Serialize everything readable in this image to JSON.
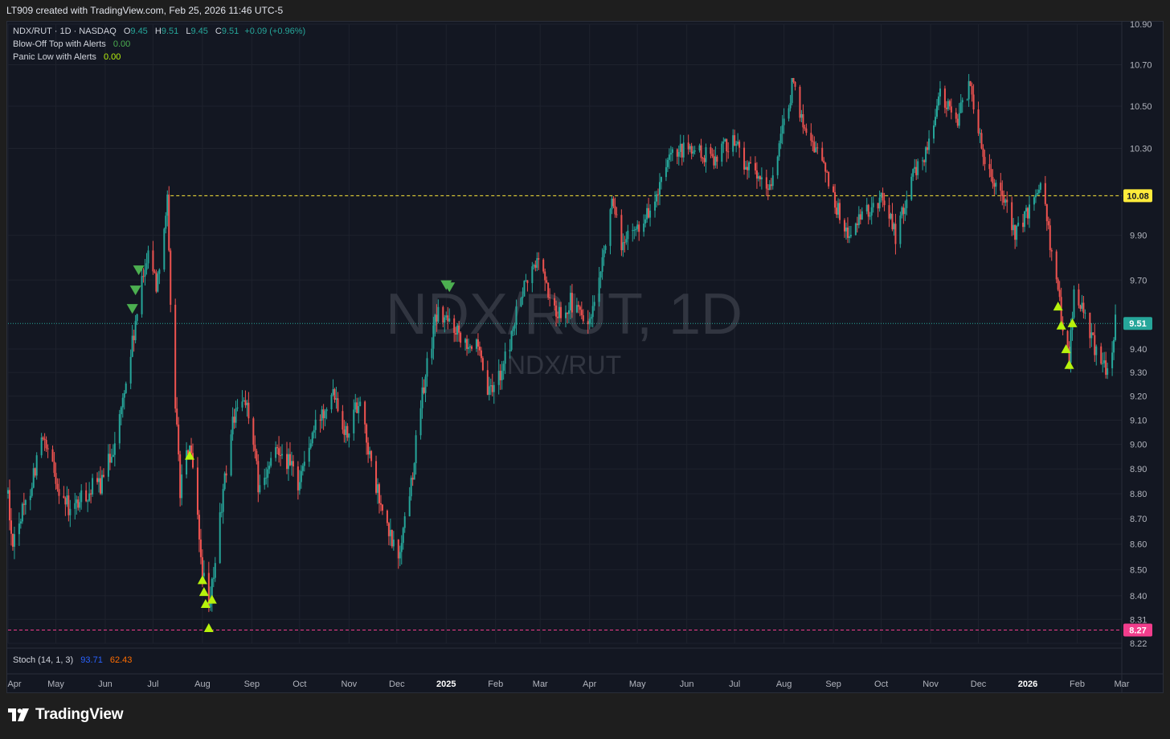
{
  "header": {
    "attribution": "LT909 created with TradingView.com, Feb 25, 2026 11:46 UTC-5"
  },
  "legend": {
    "symbol": "NDX/RUT · 1D · NASDAQ",
    "o_label": "O",
    "o_value": "9.45",
    "h_label": "H",
    "h_value": "9.51",
    "l_label": "L",
    "l_value": "9.45",
    "c_label": "C",
    "c_value": "9.51",
    "change": "+0.09 (+0.96%)",
    "indicators": [
      {
        "name": "Blow-Off Top with Alerts",
        "value": "0.00"
      },
      {
        "name": "Panic Low with Alerts",
        "value": "0.00"
      }
    ]
  },
  "watermark": {
    "main": "NDX/RUT, 1D",
    "sub": "NDX/RUT"
  },
  "stoch": {
    "name": "Stoch (14, 1, 3)",
    "k": "93.71",
    "d": "62.43"
  },
  "footer": {
    "brand": "TradingView"
  },
  "colors": {
    "up": "#26a69a",
    "down": "#ef5350",
    "grid": "#1e222d",
    "axis_text": "#b2b5be",
    "resistance": "#ffeb3b",
    "support": "#f23d8c",
    "buy_marker": "#b8f20c",
    "sell_marker": "#4caf50",
    "last_price_label": "#26a69a"
  },
  "chart_data": {
    "type": "candlestick",
    "scale": "log",
    "ylim": [
      8.22,
      10.9
    ],
    "y_ticks": [
      10.9,
      10.7,
      10.5,
      10.3,
      9.9,
      9.7,
      9.4,
      9.3,
      9.2,
      9.1,
      9.0,
      8.9,
      8.8,
      8.7,
      8.6,
      8.5,
      8.4,
      8.31,
      8.22
    ],
    "x_ticks": [
      "Apr",
      "May",
      "Jun",
      "Jul",
      "Aug",
      "Sep",
      "Oct",
      "Nov",
      "Dec",
      "2025",
      "Feb",
      "Mar",
      "Apr",
      "May",
      "Jun",
      "Jul",
      "Aug",
      "Sep",
      "Oct",
      "Nov",
      "Dec",
      "2026",
      "Feb",
      "Mar"
    ],
    "x_start": "2024-04-01",
    "x_end": "2026-03-01",
    "horizontal_lines": [
      {
        "value": 10.08,
        "label": "10.08",
        "style": "dashed",
        "color": "#ffeb3b"
      },
      {
        "value": 8.27,
        "label": "8.27",
        "style": "dashed",
        "color": "#f23d8c"
      },
      {
        "value": 9.51,
        "label": "9.51",
        "style": "dotted",
        "color": "#26a69a"
      }
    ],
    "price_path": [
      [
        "2024-04-01",
        8.8
      ],
      [
        "2024-04-03",
        8.62
      ],
      [
        "2024-04-12",
        8.75
      ],
      [
        "2024-04-22",
        9.02
      ],
      [
        "2024-04-30",
        8.88
      ],
      [
        "2024-05-10",
        8.72
      ],
      [
        "2024-05-20",
        8.8
      ],
      [
        "2024-05-31",
        8.85
      ],
      [
        "2024-06-10",
        9.1
      ],
      [
        "2024-06-20",
        9.5
      ],
      [
        "2024-06-28",
        9.85
      ],
      [
        "2024-07-03",
        9.68
      ],
      [
        "2024-07-10",
        10.05
      ],
      [
        "2024-07-12",
        9.55
      ],
      [
        "2024-07-18",
        8.82
      ],
      [
        "2024-07-24",
        9.0
      ],
      [
        "2024-07-31",
        8.55
      ],
      [
        "2024-08-05",
        8.32
      ],
      [
        "2024-08-12",
        8.7
      ],
      [
        "2024-08-20",
        9.1
      ],
      [
        "2024-08-28",
        9.2
      ],
      [
        "2024-09-06",
        8.8
      ],
      [
        "2024-09-18",
        9.0
      ],
      [
        "2024-09-30",
        8.85
      ],
      [
        "2024-10-10",
        9.05
      ],
      [
        "2024-10-22",
        9.25
      ],
      [
        "2024-10-30",
        9.05
      ],
      [
        "2024-11-08",
        9.2
      ],
      [
        "2024-11-15",
        8.9
      ],
      [
        "2024-11-25",
        8.65
      ],
      [
        "2024-12-02",
        8.55
      ],
      [
        "2024-12-10",
        8.85
      ],
      [
        "2024-12-18",
        9.25
      ],
      [
        "2024-12-26",
        9.55
      ],
      [
        "2025-01-06",
        9.5
      ],
      [
        "2025-01-20",
        9.4
      ],
      [
        "2025-01-28",
        9.2
      ],
      [
        "2025-02-07",
        9.35
      ],
      [
        "2025-02-18",
        9.65
      ],
      [
        "2025-02-28",
        9.8
      ],
      [
        "2025-03-10",
        9.55
      ],
      [
        "2025-03-20",
        9.6
      ],
      [
        "2025-04-01",
        9.5
      ],
      [
        "2025-04-08",
        9.7
      ],
      [
        "2025-04-14",
        10.05
      ],
      [
        "2025-04-22",
        9.85
      ],
      [
        "2025-05-02",
        9.95
      ],
      [
        "2025-05-12",
        10.05
      ],
      [
        "2025-05-22",
        10.25
      ],
      [
        "2025-06-02",
        10.3
      ],
      [
        "2025-06-16",
        10.25
      ],
      [
        "2025-06-30",
        10.35
      ],
      [
        "2025-07-10",
        10.2
      ],
      [
        "2025-07-22",
        10.1
      ],
      [
        "2025-08-01",
        10.4
      ],
      [
        "2025-08-06",
        10.6
      ],
      [
        "2025-08-14",
        10.4
      ],
      [
        "2025-08-25",
        10.25
      ],
      [
        "2025-09-02",
        10.05
      ],
      [
        "2025-09-10",
        9.9
      ],
      [
        "2025-09-22",
        10.0
      ],
      [
        "2025-10-03",
        10.08
      ],
      [
        "2025-10-10",
        9.9
      ],
      [
        "2025-10-20",
        10.15
      ],
      [
        "2025-10-30",
        10.3
      ],
      [
        "2025-11-06",
        10.55
      ],
      [
        "2025-11-18",
        10.45
      ],
      [
        "2025-11-26",
        10.6
      ],
      [
        "2025-12-05",
        10.25
      ],
      [
        "2025-12-15",
        10.1
      ],
      [
        "2025-12-24",
        9.9
      ],
      [
        "2026-01-05",
        10.05
      ],
      [
        "2026-01-10",
        10.2
      ],
      [
        "2026-01-16",
        9.8
      ],
      [
        "2026-01-22",
        9.55
      ],
      [
        "2026-01-27",
        9.38
      ],
      [
        "2026-01-30",
        9.65
      ],
      [
        "2026-02-05",
        9.55
      ],
      [
        "2026-02-10",
        9.45
      ],
      [
        "2026-02-16",
        9.35
      ],
      [
        "2026-02-20",
        9.3
      ],
      [
        "2026-02-25",
        9.51
      ]
    ],
    "panic_low_markers": [
      "2024-07-24",
      "2024-08-01",
      "2024-08-02",
      "2024-08-03",
      "2024-08-05",
      "2024-08-07",
      "2026-01-20",
      "2026-01-22",
      "2026-01-25",
      "2026-01-27",
      "2026-01-29"
    ],
    "blow_off_top_markers": [
      "2024-06-18",
      "2024-06-20",
      "2024-06-22",
      "2025-01-01",
      "2025-01-03"
    ]
  }
}
